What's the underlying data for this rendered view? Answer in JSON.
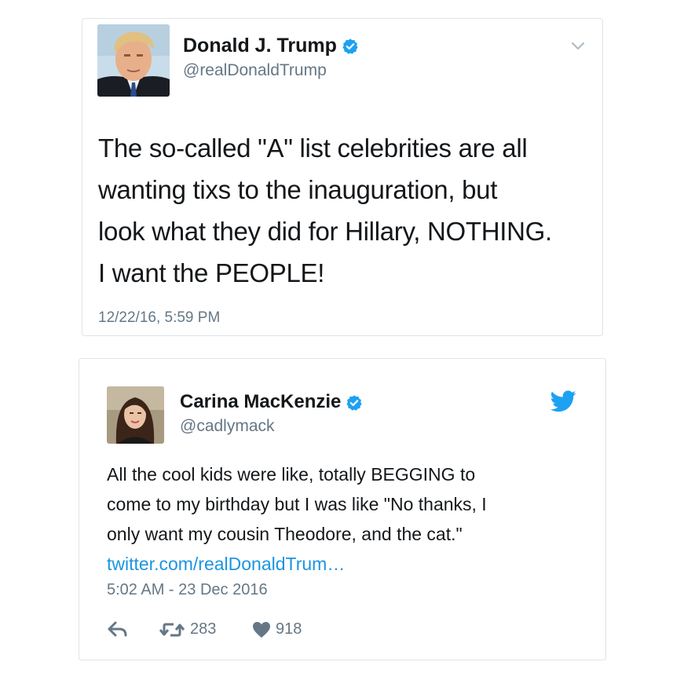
{
  "tweet1": {
    "author_name": "Donald J. Trump",
    "handle": "@realDonaldTrump",
    "text_lines": [
      "The so-called \"A\" list celebrities are all",
      "wanting tixs to the inauguration, but",
      "look what they did for Hillary, NOTHING.",
      "I want the PEOPLE!"
    ],
    "timestamp": "12/22/16, 5:59 PM",
    "menu_icon": "chevron-down-icon",
    "verified_icon": "verified-badge-icon"
  },
  "tweet2": {
    "author_name": "Carina MacKenzie",
    "handle": "@cadlymack",
    "text_lines": [
      "All the cool kids were like, totally BEGGING to",
      "come to my birthday but I was like \"No thanks, I",
      "only want my cousin Theodore, and the cat.\""
    ],
    "link": "twitter.com/realDonaldTrum…",
    "timestamp": "5:02 AM - 23 Dec 2016",
    "retweet_count": "283",
    "like_count": "918",
    "brand_icon": "twitter-bird-icon",
    "verified_icon": "verified-badge-icon",
    "action_icons": [
      "reply-icon",
      "retweet-icon",
      "heart-icon"
    ]
  },
  "colors": {
    "verified": "#1da1f2",
    "link": "#1b95e0",
    "secondary_text": "#657786",
    "primary_text": "#14171a",
    "border": "#dfe3e8"
  }
}
